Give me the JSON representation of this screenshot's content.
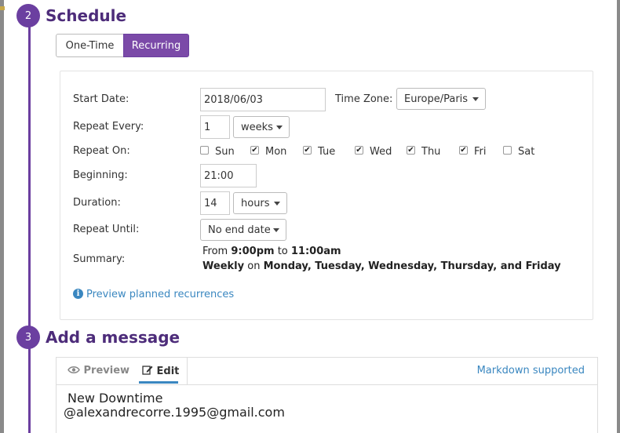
{
  "schedule": {
    "step_number": "2",
    "title": "Schedule",
    "mode_tabs": [
      "One-Time",
      "Recurring"
    ],
    "active_mode": "Recurring"
  },
  "form": {
    "start_date_label": "Start Date:",
    "start_date_value": "2018/06/03",
    "timezone_label": "Time Zone:",
    "timezone_value": "Europe/Paris",
    "repeat_every_label": "Repeat Every:",
    "repeat_every_value": "1",
    "repeat_every_unit": "weeks",
    "repeat_on_label": "Repeat On:",
    "days": [
      {
        "label": "Sun",
        "checked": false
      },
      {
        "label": "Mon",
        "checked": true
      },
      {
        "label": "Tue",
        "checked": true
      },
      {
        "label": "Wed",
        "checked": true
      },
      {
        "label": "Thu",
        "checked": true
      },
      {
        "label": "Fri",
        "checked": true
      },
      {
        "label": "Sat",
        "checked": false
      }
    ],
    "beginning_label": "Beginning:",
    "beginning_value": "21:00",
    "duration_label": "Duration:",
    "duration_value": "14",
    "duration_unit": "hours",
    "repeat_until_label": "Repeat Until:",
    "repeat_until_value": "No end date",
    "summary_label": "Summary:",
    "summary_line1": {
      "from": "From",
      "start": "9:00pm",
      "to": "to",
      "end": "11:00am"
    },
    "summary_line2": {
      "freq": "Weekly",
      "on": "on",
      "days": "Monday, Tuesday, Wednesday, Thursday, and Friday"
    },
    "preview_link": "Preview planned recurrences"
  },
  "message": {
    "step_number": "3",
    "title": "Add a message",
    "tab_preview": "Preview",
    "tab_edit": "Edit",
    "markdown_note": "Markdown supported",
    "text_line1": "New Downtime",
    "text_line2": "@alexandrecorre.1995@gmail.com"
  },
  "colors": {
    "accent": "#6b3fa0",
    "title": "#4d2c7a",
    "link": "#3a87c0"
  },
  "icons": [
    "info-icon",
    "eye-icon",
    "edit-icon",
    "chevron-down-icon",
    "checkbox-icon"
  ]
}
